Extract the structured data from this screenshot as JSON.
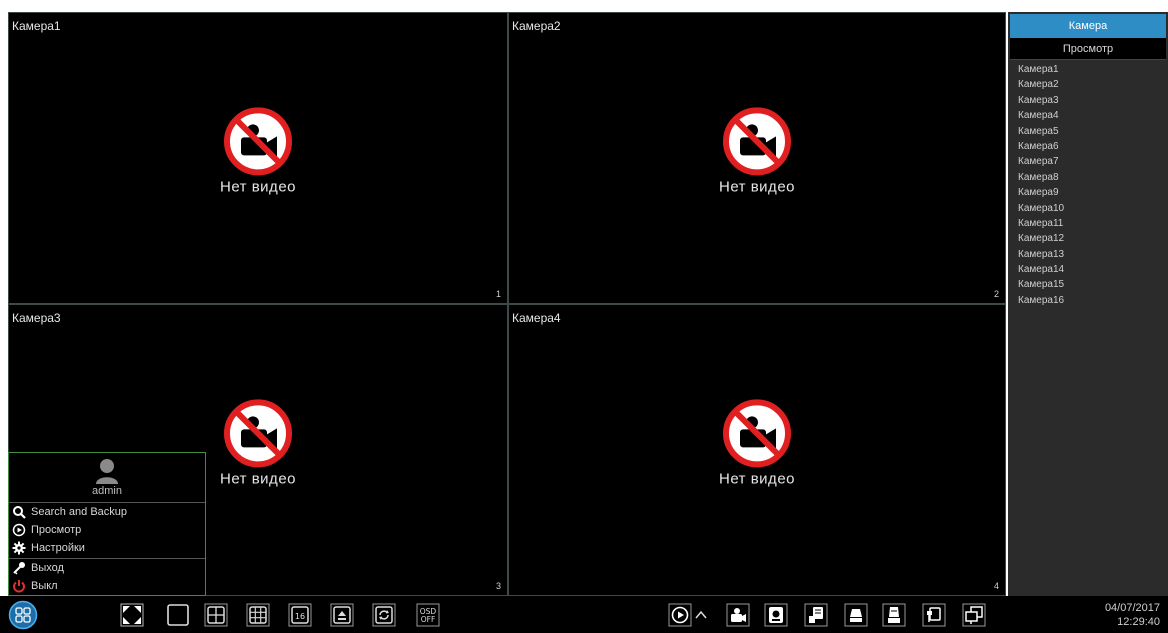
{
  "tiles": [
    {
      "title": "Камера1",
      "message": "Нет видео",
      "number": "1"
    },
    {
      "title": "Камера2",
      "message": "Нет видео",
      "number": "2"
    },
    {
      "title": "Камера3",
      "message": "Нет видео",
      "number": "3"
    },
    {
      "title": "Камера4",
      "message": "Нет видео",
      "number": "4"
    }
  ],
  "sidepanel": {
    "tab_camera": "Камера",
    "tab_view": "Просмотр",
    "cameras": [
      "Камера1",
      "Камера2",
      "Камера3",
      "Камера4",
      "Камера5",
      "Камера6",
      "Камера7",
      "Камера8",
      "Камера9",
      "Камера10",
      "Камера11",
      "Камера12",
      "Камера13",
      "Камера14",
      "Камера15",
      "Камера16"
    ]
  },
  "start_menu": {
    "username": "admin",
    "items": {
      "search": "Search and Backup",
      "playback": "Просмотр",
      "settings": "Настройки",
      "logout": "Выход",
      "shutdown": "Выкл"
    }
  },
  "toolbar": {
    "osd_label": "OSD",
    "osd_state": "OFF",
    "layout_16_label": "16",
    "date": "04/07/2017",
    "time": "12:29:40"
  },
  "colors": {
    "accent": "#2d8dc4",
    "menu_border": "#3e8e3e",
    "shutdown": "#e03030",
    "novideo_red": "#e02020"
  },
  "icons": {
    "novideo": "no-camera-icon",
    "start": "start-menu-icon",
    "search": "search-icon",
    "playback": "play-circle-icon",
    "settings": "gear-icon",
    "logout": "key-icon",
    "shutdown": "power-icon"
  }
}
